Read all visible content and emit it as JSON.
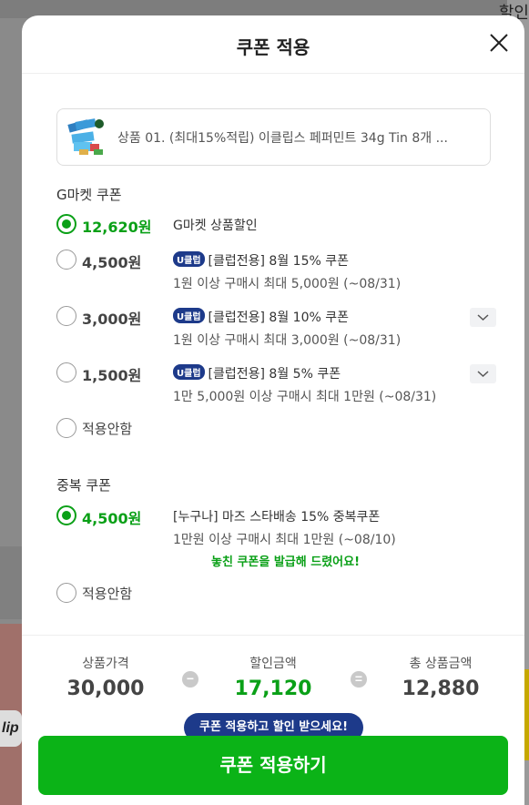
{
  "modal": {
    "title": "쿠폰 적용",
    "close_icon": "close-icon"
  },
  "product": {
    "name": "상품 01. (최대15%적립) 이클립스 페퍼민트 34g Tin 8개 ...",
    "thumb_icon": "product-thumbnail"
  },
  "gmarket_section": {
    "label": "G마켓 쿠폰",
    "options": [
      {
        "amount": "12,620원",
        "desc": "G마켓 상품할인",
        "badge": "",
        "subdesc": "",
        "checked": true
      },
      {
        "amount": "4,500원",
        "badge": "U클럽",
        "desc": "[클럽전용] 8월 15% 쿠폰",
        "subdesc": "1원 이상 구매시 최대 5,000원 (~08/31)",
        "checked": false
      },
      {
        "amount": "3,000원",
        "badge": "U클럽",
        "desc": "[클럽전용] 8월 10% 쿠폰",
        "subdesc": "1원 이상 구매시 최대 3,000원 (~08/31)",
        "checked": false
      },
      {
        "amount": "1,500원",
        "badge": "U클럽",
        "desc": "[클럽전용] 8월 5% 쿠폰",
        "subdesc": "1만 5,000원 이상 구매시 최대 1만원 (~08/31)",
        "checked": false
      }
    ],
    "none_label": "적용안함"
  },
  "duplicate_section": {
    "label": "중복 쿠폰",
    "option": {
      "amount": "4,500원",
      "desc": "[누구나] 마즈 스타배송 15% 중복쿠폰",
      "subdesc": "1만원 이상 구매시 최대 1만원 (~08/10)",
      "notice": "놓친 쿠폰을 발급해 드렸어요!",
      "checked": true
    },
    "none_label": "적용안함"
  },
  "summary": {
    "price_label": "상품가격",
    "price_value": "30,000",
    "discount_label": "할인금액",
    "discount_value": "17,120",
    "total_label": "총 상품금액",
    "total_value": "12,880",
    "minus": "−",
    "equals": "="
  },
  "tooltip": "쿠폰 적용하고 할인 받으세요!",
  "apply_button": "쿠폰 적용하기",
  "background": {
    "right_text": "할인"
  },
  "colors": {
    "accent_green": "#0bb317",
    "badge_navy": "#1d3a8a"
  }
}
